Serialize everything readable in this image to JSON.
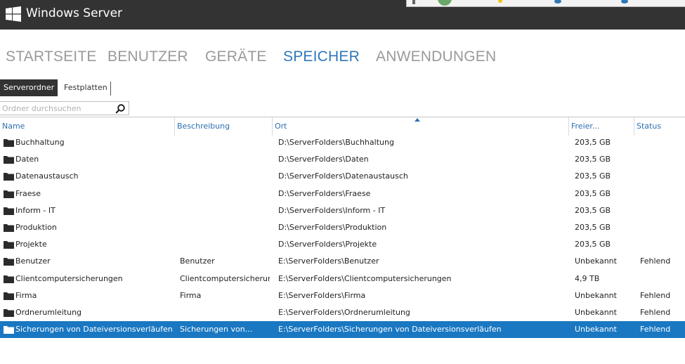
{
  "app": {
    "title": "Windows Server"
  },
  "nav": {
    "items": [
      {
        "label": "STARTSEITE"
      },
      {
        "label": "BENUTZER"
      },
      {
        "label": "GERÄTE"
      },
      {
        "label": "SPEICHER"
      },
      {
        "label": "ANWENDUNGEN"
      }
    ],
    "active_index": 3
  },
  "subtabs": [
    {
      "label": "Serverordner"
    },
    {
      "label": "Festplatten"
    }
  ],
  "search": {
    "placeholder": "Ordner durchsuchen",
    "value": ""
  },
  "table": {
    "columns": [
      "Name",
      "Beschreibung",
      "Ort",
      "Freier...",
      "Status"
    ],
    "sorted_column": "Ort",
    "rows": [
      {
        "name": "Buchhaltung",
        "desc": "",
        "ort": "D:\\ServerFolders\\Buchhaltung",
        "free": "203,5 GB",
        "status": ""
      },
      {
        "name": "Daten",
        "desc": "",
        "ort": "D:\\ServerFolders\\Daten",
        "free": "203,5 GB",
        "status": ""
      },
      {
        "name": "Datenaustausch",
        "desc": "",
        "ort": "D:\\ServerFolders\\Datenaustausch",
        "free": "203,5 GB",
        "status": ""
      },
      {
        "name": "Fraese",
        "desc": "",
        "ort": "D:\\ServerFolders\\Fraese",
        "free": "203,5 GB",
        "status": ""
      },
      {
        "name": "Inform - IT",
        "desc": "",
        "ort": "D:\\ServerFolders\\Inform - IT",
        "free": "203,5 GB",
        "status": ""
      },
      {
        "name": "Produktion",
        "desc": "",
        "ort": "D:\\ServerFolders\\Produktion",
        "free": "203,5 GB",
        "status": ""
      },
      {
        "name": "Projekte",
        "desc": "",
        "ort": "D:\\ServerFolders\\Projekte",
        "free": "203,5 GB",
        "status": ""
      },
      {
        "name": "Benutzer",
        "desc": "Benutzer",
        "ort": "E:\\ServerFolders\\Benutzer",
        "free": "Unbekannt",
        "status": "Fehlend"
      },
      {
        "name": "Clientcomputersicherungen",
        "desc": "Clientcomputersicherun...",
        "ort": "E:\\ServerFolders\\Clientcomputersicherungen",
        "free": "4,9 TB",
        "status": ""
      },
      {
        "name": "Firma",
        "desc": "Firma",
        "ort": "E:\\ServerFolders\\Firma",
        "free": "Unbekannt",
        "status": "Fehlend"
      },
      {
        "name": "Ordnerumleitung",
        "desc": "",
        "ort": "E:\\ServerFolders\\Ordnerumleitung",
        "free": "Unbekannt",
        "status": "Fehlend"
      },
      {
        "name": "Sicherungen von Dateiversionsverläufen",
        "desc": "Sicherungen von...",
        "ort": "E:\\ServerFolders\\Sicherungen von Dateiversionsverläufen",
        "free": "Unbekannt",
        "status": "Fehlend"
      }
    ],
    "selected_index": 11
  },
  "icons": {
    "logo": "windows-logo-icon",
    "search": "search-icon",
    "folder": "folder-icon",
    "sort": "sort-ascending-icon"
  },
  "colors": {
    "titlebar": "#333333",
    "accent": "#2f77b8",
    "selection": "#1a78c2",
    "inactive_nav": "#9a9a9a"
  }
}
